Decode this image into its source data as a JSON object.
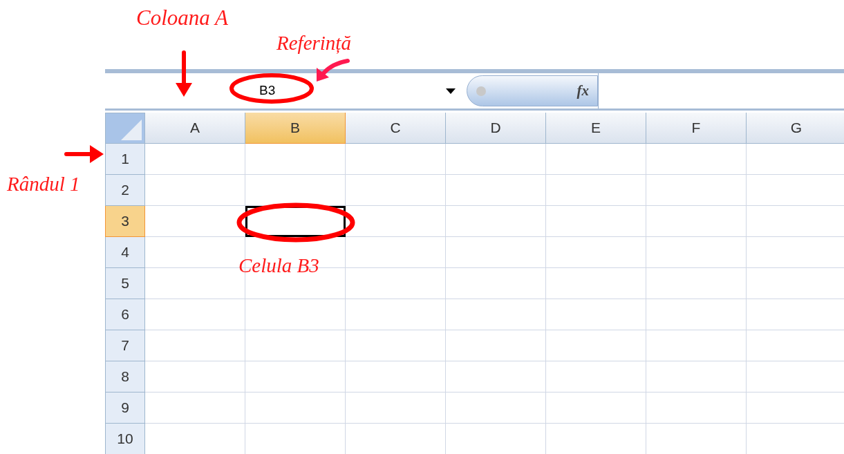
{
  "annotations": [
    {
      "kind": "label",
      "text": "Coloana A"
    },
    {
      "kind": "label",
      "text": "Referință"
    },
    {
      "kind": "label",
      "text": "Rândul 1"
    },
    {
      "kind": "label",
      "text": "Celula B3"
    }
  ],
  "name_box": {
    "value": "B3"
  },
  "function_button": {
    "label": "fx"
  },
  "columns": [
    {
      "label": "A",
      "selected": false
    },
    {
      "label": "B",
      "selected": true
    },
    {
      "label": "C",
      "selected": false
    },
    {
      "label": "D",
      "selected": false
    },
    {
      "label": "E",
      "selected": false
    },
    {
      "label": "F",
      "selected": false
    },
    {
      "label": "G",
      "selected": false
    }
  ],
  "rows": [
    {
      "label": "1",
      "selected": false
    },
    {
      "label": "2",
      "selected": false
    },
    {
      "label": "3",
      "selected": true
    },
    {
      "label": "4",
      "selected": false
    },
    {
      "label": "5",
      "selected": false
    },
    {
      "label": "6",
      "selected": false
    },
    {
      "label": "7",
      "selected": false
    },
    {
      "label": "8",
      "selected": false
    },
    {
      "label": "9",
      "selected": false
    },
    {
      "label": "10",
      "selected": false
    }
  ]
}
